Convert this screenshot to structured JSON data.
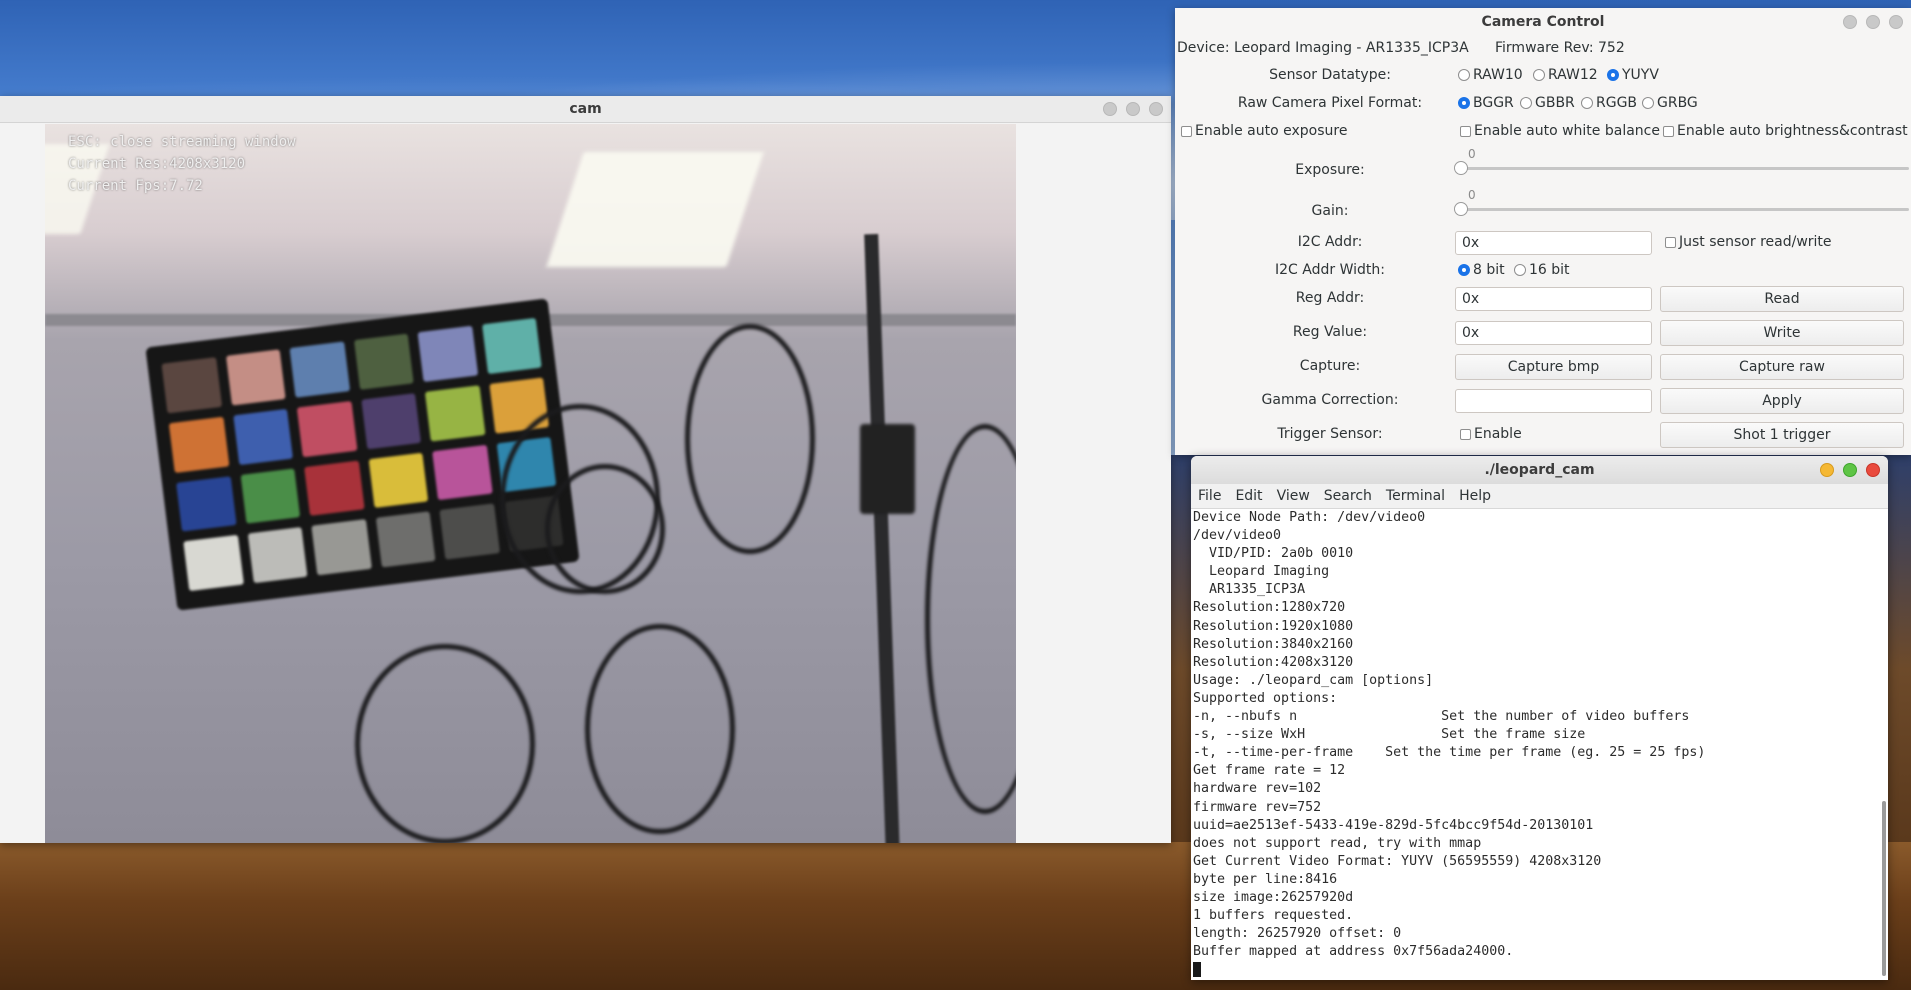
{
  "cam": {
    "title": "cam",
    "overlay": [
      "ESC: close streaming window",
      "Current Res:4208x3120",
      "Current Fps:7.72"
    ],
    "checker_colors": [
      "#5a4640",
      "#c48e85",
      "#5e7fae",
      "#4e6040",
      "#7f86b8",
      "#5fb0a8",
      "#cf7234",
      "#3e5fae",
      "#c04e62",
      "#4e3f6c",
      "#97b444",
      "#dba03a",
      "#284494",
      "#4a8e48",
      "#a8323a",
      "#d9bd3a",
      "#b8549a",
      "#2f86ad",
      "#d8d8d2",
      "#bcbcb8",
      "#989894",
      "#6e6e6c",
      "#4d4d4b",
      "#2d2d2c"
    ]
  },
  "camera_control": {
    "title": "Camera Control",
    "device": "Device: Leopard Imaging - AR1335_ICP3A",
    "firmware": "Firmware Rev: 752",
    "sensor_datatype": {
      "label": "Sensor Datatype:",
      "options": [
        "RAW10",
        "RAW12",
        "YUYV"
      ],
      "selected": "YUYV"
    },
    "pixel_format": {
      "label": "Raw Camera Pixel Format:",
      "options": [
        "BGGR",
        "GBBR",
        "RGGB",
        "GRBG"
      ],
      "selected": "BGGR"
    },
    "auto_exposure": "Enable auto exposure",
    "auto_wb": "Enable auto white balance",
    "auto_bc": "Enable auto brightness&contrast",
    "exposure": {
      "label": "Exposure:",
      "value": "0"
    },
    "gain": {
      "label": "Gain:",
      "value": "0"
    },
    "i2c_addr": {
      "label": "I2C Addr:",
      "value": "0x",
      "check": "Just sensor read/write"
    },
    "i2c_width": {
      "label": "I2C Addr Width:",
      "options": [
        "8 bit",
        "16 bit"
      ],
      "selected": "8 bit"
    },
    "reg_addr": {
      "label": "Reg Addr:",
      "value": "0x",
      "button": "Read"
    },
    "reg_value": {
      "label": "Reg Value:",
      "value": "0x",
      "button": "Write"
    },
    "capture": {
      "label": "Capture:",
      "bmp": "Capture bmp",
      "raw": "Capture raw"
    },
    "gamma": {
      "label": "Gamma Correction:",
      "value": "",
      "button": "Apply"
    },
    "trigger": {
      "label": "Trigger Sensor:",
      "check": "Enable",
      "button": "Shot 1 trigger"
    }
  },
  "terminal": {
    "title": "./leopard_cam",
    "menu": [
      "File",
      "Edit",
      "View",
      "Search",
      "Terminal",
      "Help"
    ],
    "lines": [
      "Device Node Path: /dev/video0",
      "/dev/video0",
      "  VID/PID: 2a0b 0010",
      "  Leopard Imaging",
      "  AR1335_ICP3A",
      "Resolution:1280x720",
      "Resolution:1920x1080",
      "Resolution:3840x2160",
      "Resolution:4208x3120",
      "Usage: ./leopard_cam [options]",
      "Supported options:",
      "-n, --nbufs n                  Set the number of video buffers",
      "-s, --size WxH                 Set the frame size",
      "-t, --time-per-frame    Set the time per frame (eg. 25 = 25 fps)",
      "Get frame rate = 12",
      "hardware rev=102",
      "firmware rev=752",
      "uuid=ae2513ef-5433-419e-829d-5fc4bcc9f54d-20130101",
      "does not support read, try with mmap",
      "Get Current Video Format: YUYV (56595559) 4208x3120",
      "byte per line:8416",
      "size image:26257920d",
      "1 buffers requested.",
      "length: 26257920 offset: 0",
      "Buffer mapped at address 0x7f56ada24000."
    ]
  }
}
